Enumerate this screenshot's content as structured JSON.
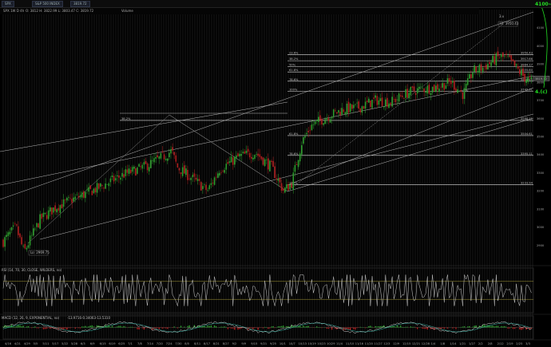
{
  "toolbar": {
    "symbol": "SPX",
    "items": [
      "S&P 500 INDEX",
      "3819.72"
    ]
  },
  "infobar": {
    "symbol_label": "SPX 1W D 4h",
    "ohlc": "O: 3812 H: 3822.99 L: 3803.47 C: 3819.72",
    "volume_label": "Volume"
  },
  "target_text": "4100-4300",
  "target_text_2": "4.(c)",
  "price_box": "3819.72",
  "colors": {
    "up": "#2e9e2e",
    "down": "#b02020",
    "fib": "#e0e0e0",
    "rsi": "#cfcfcf",
    "macd": "#d8d8d8",
    "signal": "#3cbfb0",
    "bg": "#000000"
  },
  "chart_data": {
    "type": "candlestick",
    "ylim": [
      2800,
      4200
    ],
    "x_ticks": [
      "4/16",
      "4/21",
      "4/29",
      "5/5",
      "5/11",
      "5/17",
      "5/22",
      "5/28",
      "6/3",
      "6/9",
      "6/15",
      "6/19",
      "6/25",
      "7/1",
      "7/8",
      "7/14",
      "7/20",
      "7/24",
      "7/30",
      "8/5",
      "8/11",
      "8/17",
      "8/21",
      "8/27",
      "9/2",
      "9/9",
      "9/15",
      "9/21",
      "9/25",
      "10/1",
      "10/7",
      "10/13",
      "10/19",
      "10/23",
      "10/29",
      "11/4",
      "11/10",
      "11/16",
      "11/20",
      "11/27",
      "12/3",
      "12/9",
      "12/15",
      "12/21",
      "12/28",
      "1/4",
      "1/8",
      "1/14",
      "1/21",
      "1/27",
      "2/2",
      "2/8",
      "2/12",
      "2/19",
      "2/25",
      "3/3"
    ],
    "y_ticks": [
      2900,
      3000,
      3100,
      3200,
      3300,
      3400,
      3500,
      3600,
      3700,
      3800,
      3900,
      4000,
      4100
    ],
    "fib_levels": [
      {
        "label": "23.6%",
        "value": 3950.43
      },
      {
        "label": "38.2%",
        "value": 3917.66
      },
      {
        "label": "50%",
        "value": 3884.17
      },
      {
        "label": "61.8%",
        "value": 3855.6
      },
      {
        "label": "78.6%",
        "value": 3804.65
      },
      {
        "label": "100%",
        "value": 3749.31
      },
      {
        "label": "38.2%",
        "value": 3588.11
      },
      {
        "label": "50%",
        "value": 3588.11
      },
      {
        "label": "61.8%",
        "value": 3504.61
      },
      {
        "label": "78.6%",
        "value": 3395.11
      },
      {
        "label": "100%",
        "value": 3233.94
      }
    ],
    "price_labels": [
      "3950.43",
      "3917.66",
      "3884.17",
      "3855.6",
      "3804.65",
      "3749.31",
      "3588.11",
      "3504.61",
      "3395.11",
      "3233.94"
    ],
    "annotations": [
      {
        "text": "Lo: 2969.75",
        "where": "low"
      },
      {
        "text": "Hi: 3950.43",
        "where": "high"
      },
      {
        "text": "3.v",
        "where": "high"
      },
      {
        "text": "iv",
        "where": "mid"
      }
    ],
    "panels": [
      "RSI (14, 70, 30, CLOSE, WILDERS, no)",
      "MACD (12, 26, 9, EXPONENTIAL, no)"
    ],
    "rsi_levels": [
      70,
      30
    ],
    "macd_readout": [
      "-13.9716",
      "-0.34063",
      "-13.5310"
    ],
    "series_params": {
      "seed": 7,
      "points": [
        [
          0,
          2900
        ],
        [
          20,
          3000
        ],
        [
          30,
          2860
        ],
        [
          50,
          3040
        ],
        [
          70,
          3110
        ],
        [
          95,
          3160
        ],
        [
          125,
          3220
        ],
        [
          155,
          3290
        ],
        [
          180,
          3330
        ],
        [
          205,
          3390
        ],
        [
          215,
          3420
        ],
        [
          222,
          3330
        ],
        [
          240,
          3270
        ],
        [
          260,
          3200
        ],
        [
          275,
          3320
        ],
        [
          300,
          3390
        ],
        [
          320,
          3410
        ],
        [
          340,
          3330
        ],
        [
          355,
          3200
        ],
        [
          365,
          3240
        ],
        [
          378,
          3470
        ],
        [
          390,
          3560
        ],
        [
          410,
          3610
        ],
        [
          430,
          3650
        ],
        [
          450,
          3660
        ],
        [
          470,
          3700
        ],
        [
          490,
          3690
        ],
        [
          510,
          3740
        ],
        [
          525,
          3760
        ],
        [
          545,
          3770
        ],
        [
          565,
          3800
        ],
        [
          580,
          3730
        ],
        [
          592,
          3860
        ],
        [
          605,
          3880
        ],
        [
          615,
          3910
        ],
        [
          625,
          3940
        ],
        [
          635,
          3930
        ],
        [
          648,
          3870
        ],
        [
          658,
          3820
        ],
        [
          668,
          3800
        ]
      ]
    }
  }
}
